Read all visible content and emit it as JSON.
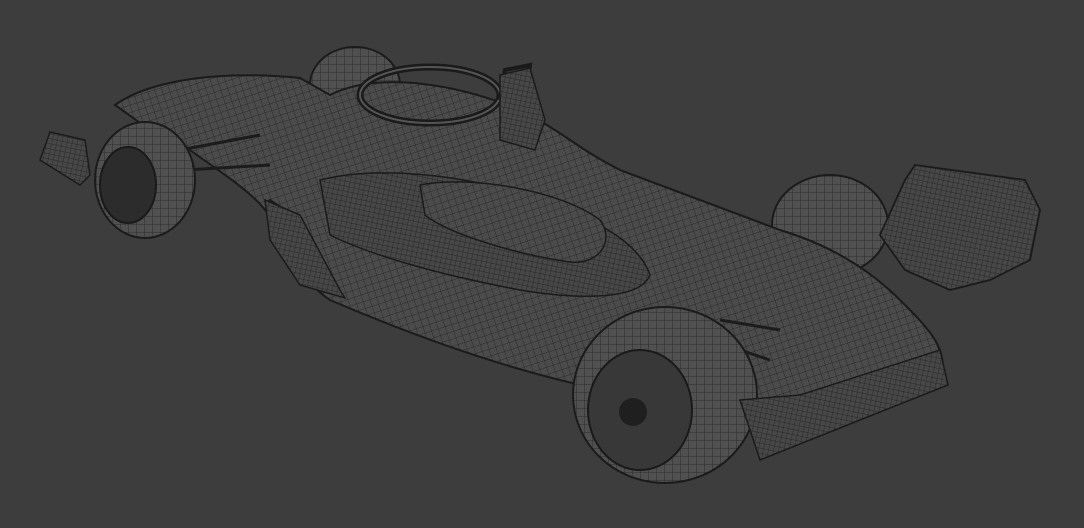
{
  "viewport": {
    "background_color": "#3d3d3d",
    "render_mode": "wireframe",
    "subject": "race-car-model",
    "mesh_fill_color": "#4a4a4a",
    "wire_color": "#1e1e1e"
  }
}
